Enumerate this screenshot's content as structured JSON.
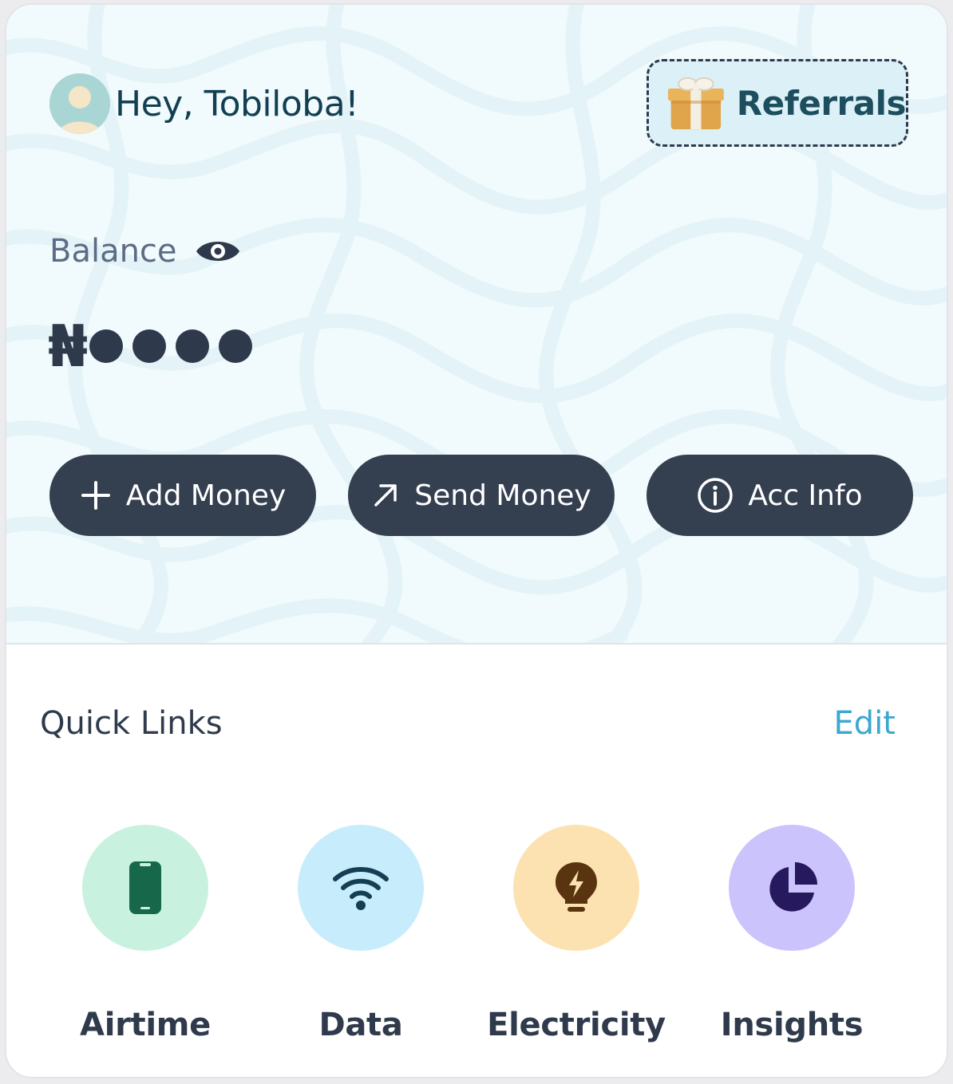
{
  "header": {
    "greeting": "Hey, Tobiloba!",
    "referrals_label": "Referrals"
  },
  "balance": {
    "label": "Balance",
    "currency_symbol": "₦",
    "masked_text": "●●●●",
    "hidden": true
  },
  "actions": [
    {
      "label": "Add Money",
      "icon": "plus-icon"
    },
    {
      "label": "Send Money",
      "icon": "arrow-up-right-icon"
    },
    {
      "label": "Acc Info",
      "icon": "info-icon"
    }
  ],
  "quick_links": {
    "title": "Quick Links",
    "edit_label": "Edit",
    "items": [
      {
        "label": "Airtime",
        "icon": "phone-icon",
        "bg": "#c8f1df",
        "fg": "#17674a"
      },
      {
        "label": "Data",
        "icon": "wifi-icon",
        "bg": "#c7ecfb",
        "fg": "#133e53"
      },
      {
        "label": "Electricity",
        "icon": "lightbulb-icon",
        "bg": "#fce2b1",
        "fg": "#5a3410"
      },
      {
        "label": "Insights",
        "icon": "pie-chart-icon",
        "bg": "#cbc3fb",
        "fg": "#26195e"
      }
    ]
  },
  "colors": {
    "primary_dark": "#343f50",
    "accent": "#3aa8cf",
    "hero_bg": "#f1fafc"
  }
}
